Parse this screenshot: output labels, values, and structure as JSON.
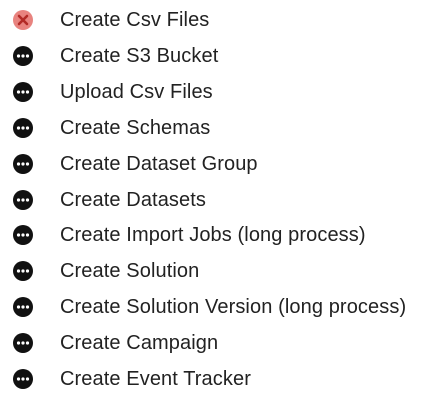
{
  "steps": [
    {
      "label": "Create Csv Files",
      "status": "error",
      "icon": "error-circle-icon"
    },
    {
      "label": "Create S3 Bucket",
      "status": "pending",
      "icon": "pending-dots-icon"
    },
    {
      "label": "Upload Csv Files",
      "status": "pending",
      "icon": "pending-dots-icon"
    },
    {
      "label": "Create Schemas",
      "status": "pending",
      "icon": "pending-dots-icon"
    },
    {
      "label": "Create Dataset Group",
      "status": "pending",
      "icon": "pending-dots-icon"
    },
    {
      "label": "Create Datasets",
      "status": "pending",
      "icon": "pending-dots-icon"
    },
    {
      "label": "Create Import Jobs (long process)",
      "status": "pending",
      "icon": "pending-dots-icon"
    },
    {
      "label": "Create Solution",
      "status": "pending",
      "icon": "pending-dots-icon"
    },
    {
      "label": "Create Solution Version (long process)",
      "status": "pending",
      "icon": "pending-dots-icon"
    },
    {
      "label": "Create Campaign",
      "status": "pending",
      "icon": "pending-dots-icon"
    },
    {
      "label": "Create Event Tracker",
      "status": "pending",
      "icon": "pending-dots-icon"
    }
  ],
  "colors": {
    "error": "#e8837f",
    "error_mark": "#b22a26",
    "pending": "#111111",
    "text": "#222222"
  }
}
